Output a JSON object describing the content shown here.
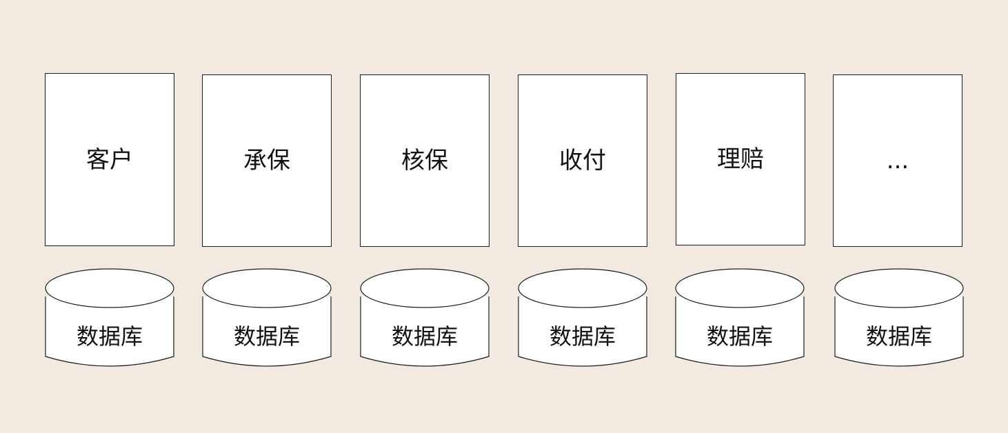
{
  "services": [
    {
      "label": "客户"
    },
    {
      "label": "承保"
    },
    {
      "label": "核保"
    },
    {
      "label": "收付"
    },
    {
      "label": "理赔"
    },
    {
      "label": "..."
    }
  ],
  "databases": [
    {
      "label": "数据库"
    },
    {
      "label": "数据库"
    },
    {
      "label": "数据库"
    },
    {
      "label": "数据库"
    },
    {
      "label": "数据库"
    },
    {
      "label": "数据库"
    }
  ],
  "colors": {
    "background": "#f2e9e0",
    "box_fill": "#ffffff",
    "stroke": "#1a1a1a"
  }
}
